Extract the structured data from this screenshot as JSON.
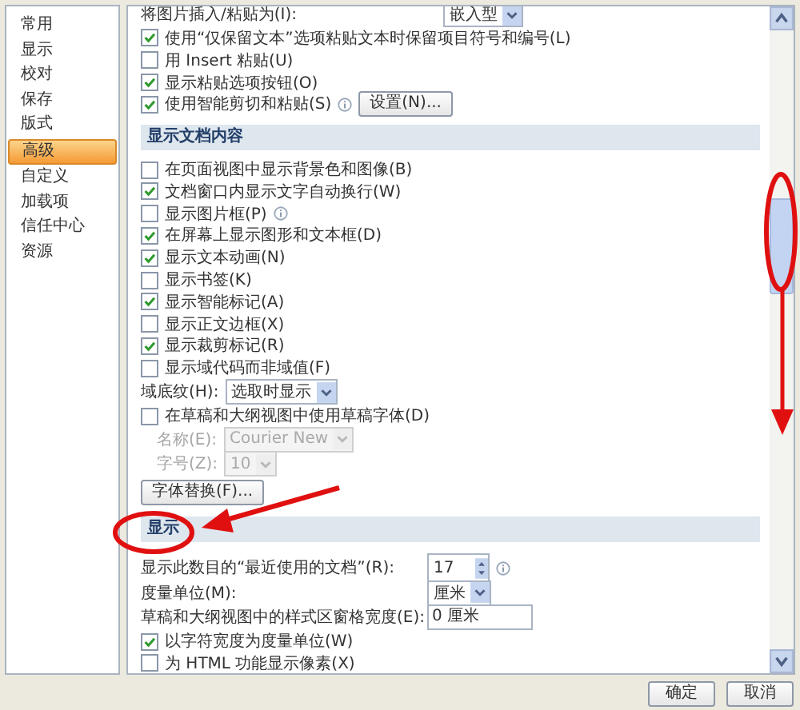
{
  "sidebar": {
    "items": [
      {
        "label": "常用",
        "selected": false
      },
      {
        "label": "显示",
        "selected": false
      },
      {
        "label": "校对",
        "selected": false
      },
      {
        "label": "保存",
        "selected": false
      },
      {
        "label": "版式",
        "selected": false
      },
      {
        "label": "高级",
        "selected": true
      },
      {
        "label": "自定义",
        "selected": false
      },
      {
        "label": "加载项",
        "selected": false
      },
      {
        "label": "信任中心",
        "selected": false
      },
      {
        "label": "资源",
        "selected": false
      }
    ]
  },
  "sections": [
    {
      "rows": [
        {
          "kind": "select",
          "label": "将图片插入/粘贴为(I):",
          "value": "嵌入型",
          "disabled": false
        },
        {
          "kind": "checkbox",
          "label": "使用“仅保留文本”选项粘贴文本时保留项目符号和编号(L)",
          "checked": true
        },
        {
          "kind": "checkbox",
          "label": "用 Insert 粘贴(U)",
          "checked": false
        },
        {
          "kind": "checkbox",
          "label": "显示粘贴选项按钮(O)",
          "checked": true
        },
        {
          "kind": "checkbox",
          "label": "使用智能剪切和粘贴(S)",
          "checked": true,
          "info": true,
          "button": "设置(N)..."
        }
      ]
    },
    {
      "title": "显示文档内容",
      "rows": [
        {
          "kind": "checkbox",
          "label": "在页面视图中显示背景色和图像(B)",
          "checked": false
        },
        {
          "kind": "checkbox",
          "label": "文档窗口内显示文字自动换行(W)",
          "checked": true
        },
        {
          "kind": "checkbox",
          "label": "显示图片框(P)",
          "checked": false,
          "info": true
        },
        {
          "kind": "checkbox",
          "label": "在屏幕上显示图形和文本框(D)",
          "checked": true
        },
        {
          "kind": "checkbox",
          "label": "显示文本动画(N)",
          "checked": true
        },
        {
          "kind": "checkbox",
          "label": "显示书签(K)",
          "checked": false
        },
        {
          "kind": "checkbox",
          "label": "显示智能标记(A)",
          "checked": true
        },
        {
          "kind": "checkbox",
          "label": "显示正文边框(X)",
          "checked": false
        },
        {
          "kind": "checkbox",
          "label": "显示裁剪标记(R)",
          "checked": true
        },
        {
          "kind": "checkbox",
          "label": "显示域代码而非域值(F)",
          "checked": false
        },
        {
          "kind": "select",
          "label": "域底纹(H):",
          "value": "选取时显示",
          "disabled": false
        },
        {
          "kind": "checkbox",
          "label": "在草稿和大纲视图中使用草稿字体(D)",
          "checked": false
        },
        {
          "kind": "select",
          "label": "名称(E):",
          "value": "Courier New",
          "disabled": true
        },
        {
          "kind": "select",
          "label": "字号(Z):",
          "value": "10",
          "disabled": true
        },
        {
          "kind": "button",
          "label": "字体替换(F)..."
        }
      ]
    },
    {
      "title": "显示",
      "rows": [
        {
          "kind": "spin",
          "label": "显示此数目的“最近使用的文档”(R):",
          "value": "17",
          "info": true
        },
        {
          "kind": "select",
          "label": "度量单位(M):",
          "value": "厘米",
          "disabled": false
        },
        {
          "kind": "input",
          "label": "草稿和大纲视图中的样式区窗格宽度(E):",
          "value": "0 厘米"
        },
        {
          "kind": "checkbox",
          "label": "以字符宽度为度量单位(W)",
          "checked": true
        },
        {
          "kind": "checkbox",
          "label": "为 HTML 功能显示像素(X)",
          "checked": false
        }
      ]
    }
  ],
  "buttons": [
    "确定",
    "取消"
  ]
}
